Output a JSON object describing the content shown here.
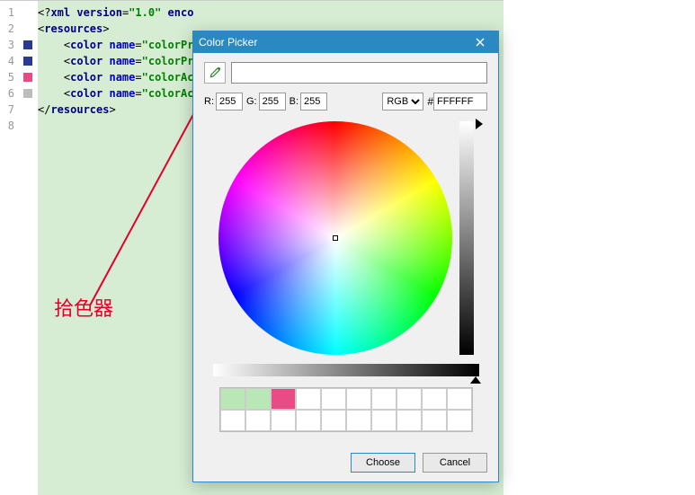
{
  "editor": {
    "lines": [
      "1",
      "2",
      "3",
      "4",
      "5",
      "6",
      "7",
      "8"
    ],
    "swatches": [
      null,
      null,
      "#2a3b8f",
      "#2a3b8f",
      "#e94b86",
      "#bdbdbd",
      null,
      null
    ],
    "code": {
      "l1_a": "<?",
      "l1_b": "xml version",
      "l1_c": "=",
      "l1_d": "\"1.0\"",
      "l1_e": " enco",
      "l2_a": "<",
      "l2_tag": "resources",
      "l2_b": ">",
      "color_open_a": "    <",
      "color_tag": "color ",
      "color_attr": "name",
      "color_eq": "=",
      "v3": "\"colorPrim",
      "v4": "\"colorPrim",
      "v5": "\"colorAcc",
      "v6": "\"colorAcc",
      "l7_a": "</",
      "l7_tag": "resources",
      "l7_b": ">"
    }
  },
  "annotation": {
    "label": "拾色器"
  },
  "dialog": {
    "title": "Color Picker",
    "r_label": "R:",
    "g_label": "G:",
    "b_label": "B:",
    "r": "255",
    "g": "255",
    "b": "255",
    "mode": "RGB",
    "hash": "#",
    "hex": "FFFFFF",
    "current_color": "#FFFFFF",
    "recent_swatches": [
      "#b9e7b5",
      "#b9e7b5",
      "#e94b86"
    ],
    "choose": "Choose",
    "cancel": "Cancel"
  }
}
